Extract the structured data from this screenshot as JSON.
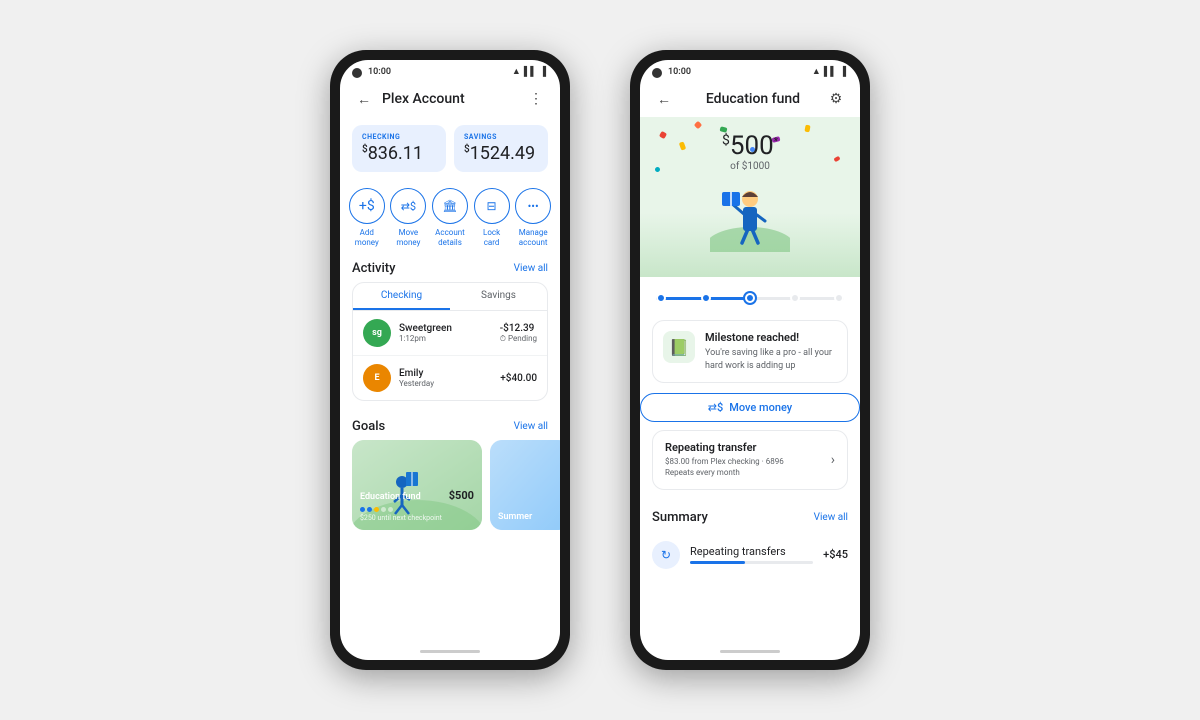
{
  "page": {
    "background": "#f0f0f0"
  },
  "phone1": {
    "status_time": "10:00",
    "app_title": "Plex Account",
    "checking_label": "CHECKING",
    "checking_amount": "836.11",
    "savings_label": "SAVINGS",
    "savings_amount": "1524.49",
    "actions": [
      {
        "label": "Add\nmoney",
        "icon": "+$"
      },
      {
        "label": "Move\nmoney",
        "icon": "↔$"
      },
      {
        "label": "Account\ndetails",
        "icon": "🏛"
      },
      {
        "label": "Lock\ncard",
        "icon": "🔒"
      },
      {
        "label": "Manage\naccount",
        "icon": "•••"
      }
    ],
    "activity_title": "Activity",
    "view_all": "View all",
    "tabs": [
      "Checking",
      "Savings"
    ],
    "active_tab": "Checking",
    "transactions": [
      {
        "name": "Sweetgreen",
        "initials": "sg",
        "time": "1:12pm",
        "amount": "-$12.39",
        "status": "Pending",
        "color": "#34a853"
      },
      {
        "name": "Emily",
        "initials": "E",
        "time": "Yesterday",
        "amount": "+$40.00",
        "status": "",
        "color": "#ea8600"
      }
    ],
    "goals_title": "Goals",
    "goals": [
      {
        "name": "Education fund",
        "amount": "$500",
        "color1": "#c8e6c9",
        "color2": "#a5d6a7",
        "sub": "$250 until next checkpoint",
        "max": "$1000"
      },
      {
        "name": "Summer",
        "amount": "",
        "color1": "#bbdefb",
        "color2": "#90caf9",
        "sub": "",
        "max": ""
      }
    ]
  },
  "phone2": {
    "status_time": "10:00",
    "title": "Education fund",
    "amount": "500",
    "amount_of": "of $1000",
    "progress_pct": 50,
    "milestone_title": "Milestone reached!",
    "milestone_desc": "You're saving like a pro - all your hard work is adding up",
    "move_money": "Move money",
    "transfer_title": "Repeating transfer",
    "transfer_sub1": "$83.00 from Plex checking · 6896",
    "transfer_sub2": "Repeats every month",
    "summary_title": "Summary",
    "view_all": "View all",
    "summary_item": "Repeating transfers",
    "summary_amount": "+$45"
  }
}
